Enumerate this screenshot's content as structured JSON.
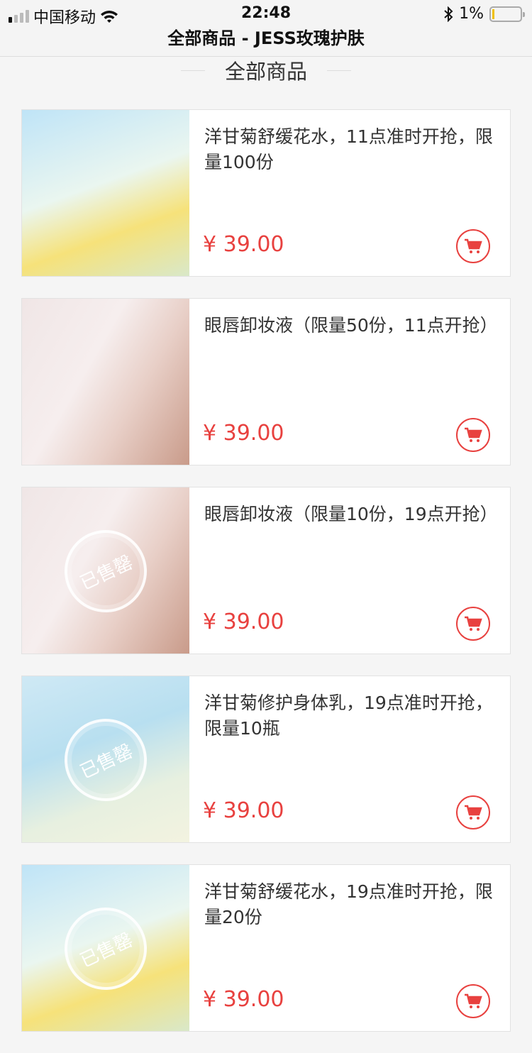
{
  "status": {
    "carrier": "中国移动",
    "time": "22:48",
    "battery": "1%",
    "battery_level": 0.01
  },
  "nav": {
    "title": "全部商品 - JESS玫瑰护肤"
  },
  "section": {
    "title": "全部商品"
  },
  "colors": {
    "price": "#e8413f"
  },
  "sold_out_label": "已售罄",
  "products": [
    {
      "title": "洋甘菊舒缓花水，11点准时开抢，限量100份",
      "price": "¥ 39.00",
      "sold_out": false
    },
    {
      "title": "眼唇卸妆液（限量50份，11点开抢）",
      "price": "¥ 39.00",
      "sold_out": false
    },
    {
      "title": "眼唇卸妆液（限量10份，19点开抢）",
      "price": "¥ 39.00",
      "sold_out": true
    },
    {
      "title": "洋甘菊修护身体乳，19点准时开抢，限量10瓶",
      "price": "¥ 39.00",
      "sold_out": true
    },
    {
      "title": "洋甘菊舒缓花水，19点准时开抢，限量20份",
      "price": "¥ 39.00",
      "sold_out": true
    }
  ]
}
